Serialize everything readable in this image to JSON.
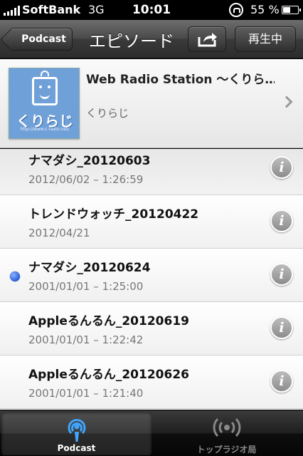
{
  "status_bar": {
    "carrier": "SoftBank",
    "network": "3G",
    "time": "10:01",
    "battery_percent": "55 %",
    "battery_level": 0.55
  },
  "nav": {
    "back_label": "Podcast",
    "title": "エピソード",
    "now_playing_label": "再生中",
    "share_icon": "share-icon"
  },
  "podcast": {
    "artwork_text": "くりらじ",
    "artwork_caption": "http://www.c-radio.net/",
    "title": "Web Radio Station 〜くりら…",
    "author": "くりらじ"
  },
  "episodes": [
    {
      "title": "ナマダシ_20120603",
      "meta": "2012/06/02 – 1:26:59",
      "unplayed": false
    },
    {
      "title": "トレンドウォッチ_20120422",
      "meta": "2012/04/21",
      "unplayed": false
    },
    {
      "title": "ナマダシ_20120624",
      "meta": "2001/01/01 – 1:25:00",
      "unplayed": true
    },
    {
      "title": "Appleるんるん_20120619",
      "meta": "2001/01/01 – 1:22:42",
      "unplayed": false
    },
    {
      "title": "Appleるんるん_20120626",
      "meta": "2001/01/01 – 1:21:40",
      "unplayed": false
    }
  ],
  "info_glyph": "i",
  "tabs": [
    {
      "label": "Podcast",
      "icon": "podcast-icon",
      "active": true
    },
    {
      "label": "トップラジオ局",
      "icon": "broadcast-icon",
      "active": false
    }
  ],
  "colors": {
    "accent_blue": "#2a5bd7",
    "tab_active_icon": "#3ea6ff"
  }
}
